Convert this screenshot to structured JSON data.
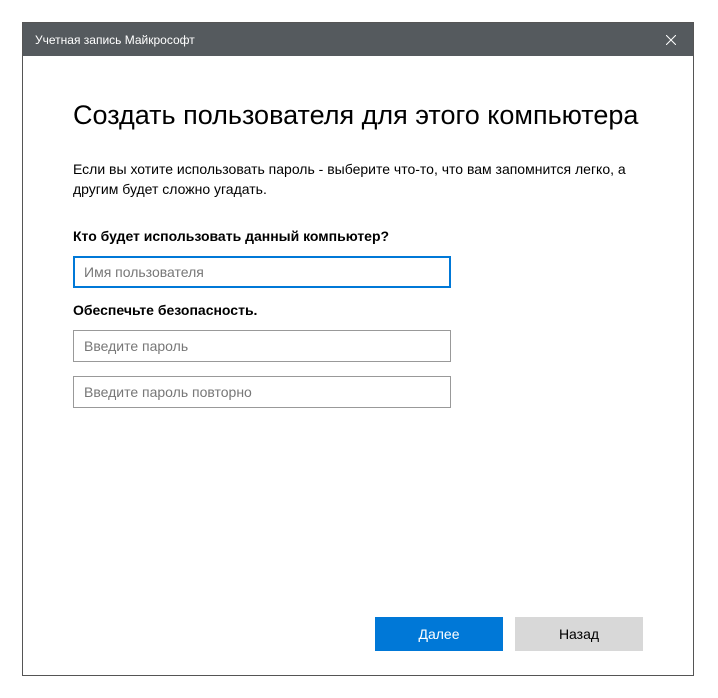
{
  "titlebar": {
    "title": "Учетная запись Майкрософт"
  },
  "main": {
    "heading": "Создать пользователя для этого компьютера",
    "description": "Если вы хотите использовать пароль - выберите что-то, что вам запомнится легко, а другим будет сложно угадать.",
    "who_label": "Кто будет использовать данный компьютер?",
    "username_placeholder": "Имя пользователя",
    "security_label": "Обеспечьте безопасность.",
    "password_placeholder": "Введите пароль",
    "password_confirm_placeholder": "Введите пароль повторно"
  },
  "buttons": {
    "next": "Далее",
    "back": "Назад"
  }
}
